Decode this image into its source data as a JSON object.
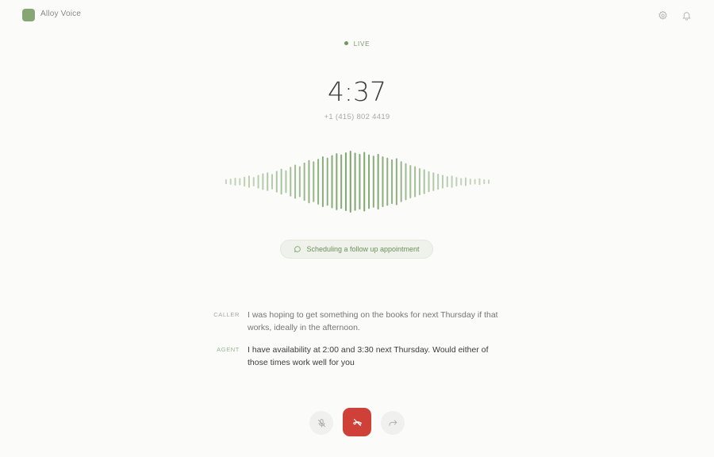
{
  "app": {
    "title": "Alloy Voice",
    "logo_color": "#86a773"
  },
  "header": {
    "icons": [
      "settings-icon",
      "bell-icon"
    ]
  },
  "call": {
    "status": "LIVE",
    "timer": "4:37",
    "phone_number": "+1 (415) 802 4419",
    "activity": "Scheduling a follow up appointment",
    "waveform_levels": [
      0.08,
      0.1,
      0.13,
      0.12,
      0.16,
      0.2,
      0.15,
      0.22,
      0.27,
      0.3,
      0.25,
      0.35,
      0.42,
      0.37,
      0.48,
      0.55,
      0.5,
      0.62,
      0.7,
      0.66,
      0.74,
      0.82,
      0.78,
      0.86,
      0.92,
      0.88,
      0.95,
      1.0,
      0.94,
      0.9,
      0.96,
      0.88,
      0.84,
      0.9,
      0.82,
      0.78,
      0.72,
      0.76,
      0.66,
      0.6,
      0.54,
      0.5,
      0.44,
      0.4,
      0.34,
      0.3,
      0.26,
      0.22,
      0.18,
      0.2,
      0.15,
      0.12,
      0.14,
      0.1,
      0.09,
      0.11,
      0.08,
      0.07
    ],
    "wave_color": "#6f9a5c"
  },
  "transcript": [
    {
      "speaker": "CALLER",
      "text": "I was hoping to get something on the books for next Thursday if that works, ideally in the afternoon."
    },
    {
      "speaker": "AGENT",
      "text": "I have availability at 2:00 and 3:30 next Thursday. Would either of those times work well for you"
    }
  ],
  "controls": {
    "mute_icon": "mic-off-icon",
    "end_icon": "phone-hangup-icon",
    "transfer_icon": "forward-arrow-icon",
    "end_color": "#cf4038"
  }
}
